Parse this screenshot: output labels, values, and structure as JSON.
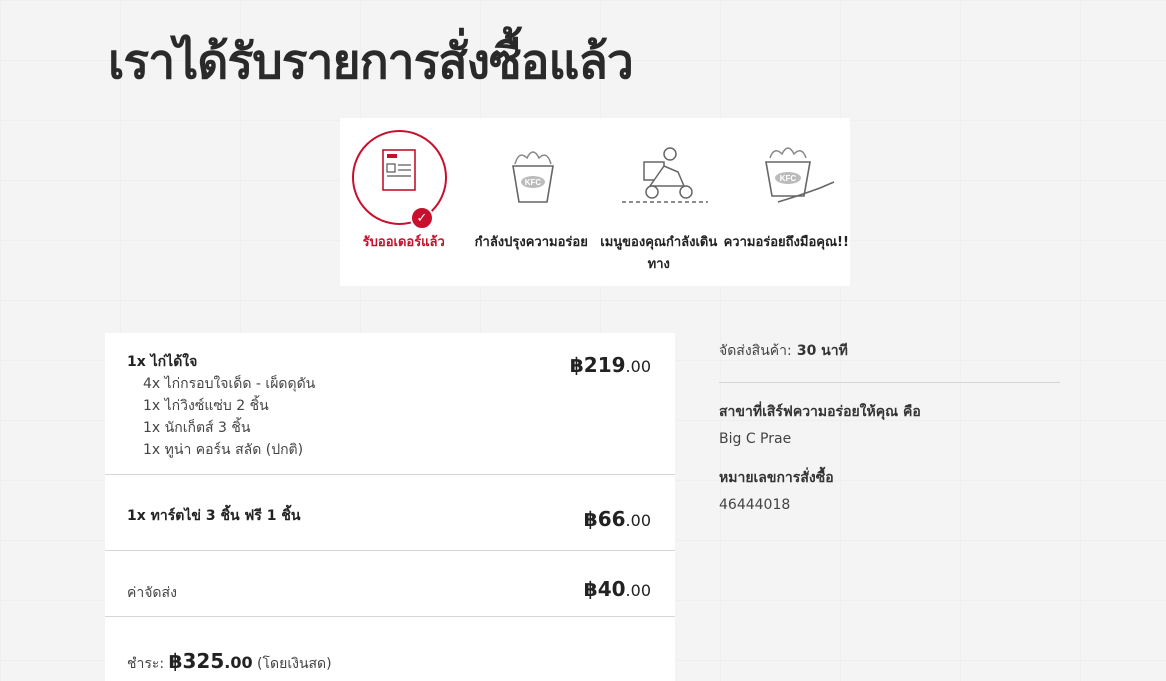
{
  "page": {
    "title": "เราได้รับรายการสั่งซื้อแล้ว"
  },
  "steps": [
    {
      "label": "รับออเดอร์แล้ว",
      "icon": "receipt-icon",
      "active": true
    },
    {
      "label": "กำลังปรุงความอร่อย",
      "icon": "chicken-bucket-icon",
      "active": false
    },
    {
      "label": "เมนูของคุณกำลังเดินทาง",
      "icon": "delivery-scooter-icon",
      "active": false
    },
    {
      "label": "ความอร่อยถึงมือคุณ!!",
      "icon": "bucket-hand-icon",
      "active": false
    }
  ],
  "colors": {
    "accent": "#c8102e"
  },
  "order": {
    "items": [
      {
        "name": "1x ไก่ได้ใจ",
        "subitems": [
          "4x ไก่กรอบใจเด็ด - เผ็ดดุดัน",
          "1x ไก่วิงซ์แซ่บ 2 ชิ้น",
          "1x นักเก็ตส์ 3 ชิ้น",
          "1x ทูน่า คอร์น สลัด (ปกติ)"
        ],
        "price_main": "฿219",
        "price_dec": ".00"
      },
      {
        "name": "1x ทาร์ตไข่ 3 ชิ้น ฟรี 1 ชิ้น",
        "subitems": [],
        "price_main": "฿66",
        "price_dec": ".00"
      }
    ],
    "delivery": {
      "label": "ค่าจัดส่ง",
      "price_main": "฿40",
      "price_dec": ".00"
    },
    "total": {
      "label": "ชำระ:",
      "amount_main": "฿325",
      "amount_dec": ".00",
      "method": "(โดยเงินสด)"
    }
  },
  "info": {
    "delivery_time_label": "จัดส่งสินค้า:",
    "delivery_time_value": "30 นาที",
    "branch_label": "สาขาที่เสิร์ฟความอร่อยให้คุณ คือ",
    "branch_value": "Big C Prae",
    "order_number_label": "หมายเลขการสั่งซื้อ",
    "order_number_value": "46444018"
  }
}
